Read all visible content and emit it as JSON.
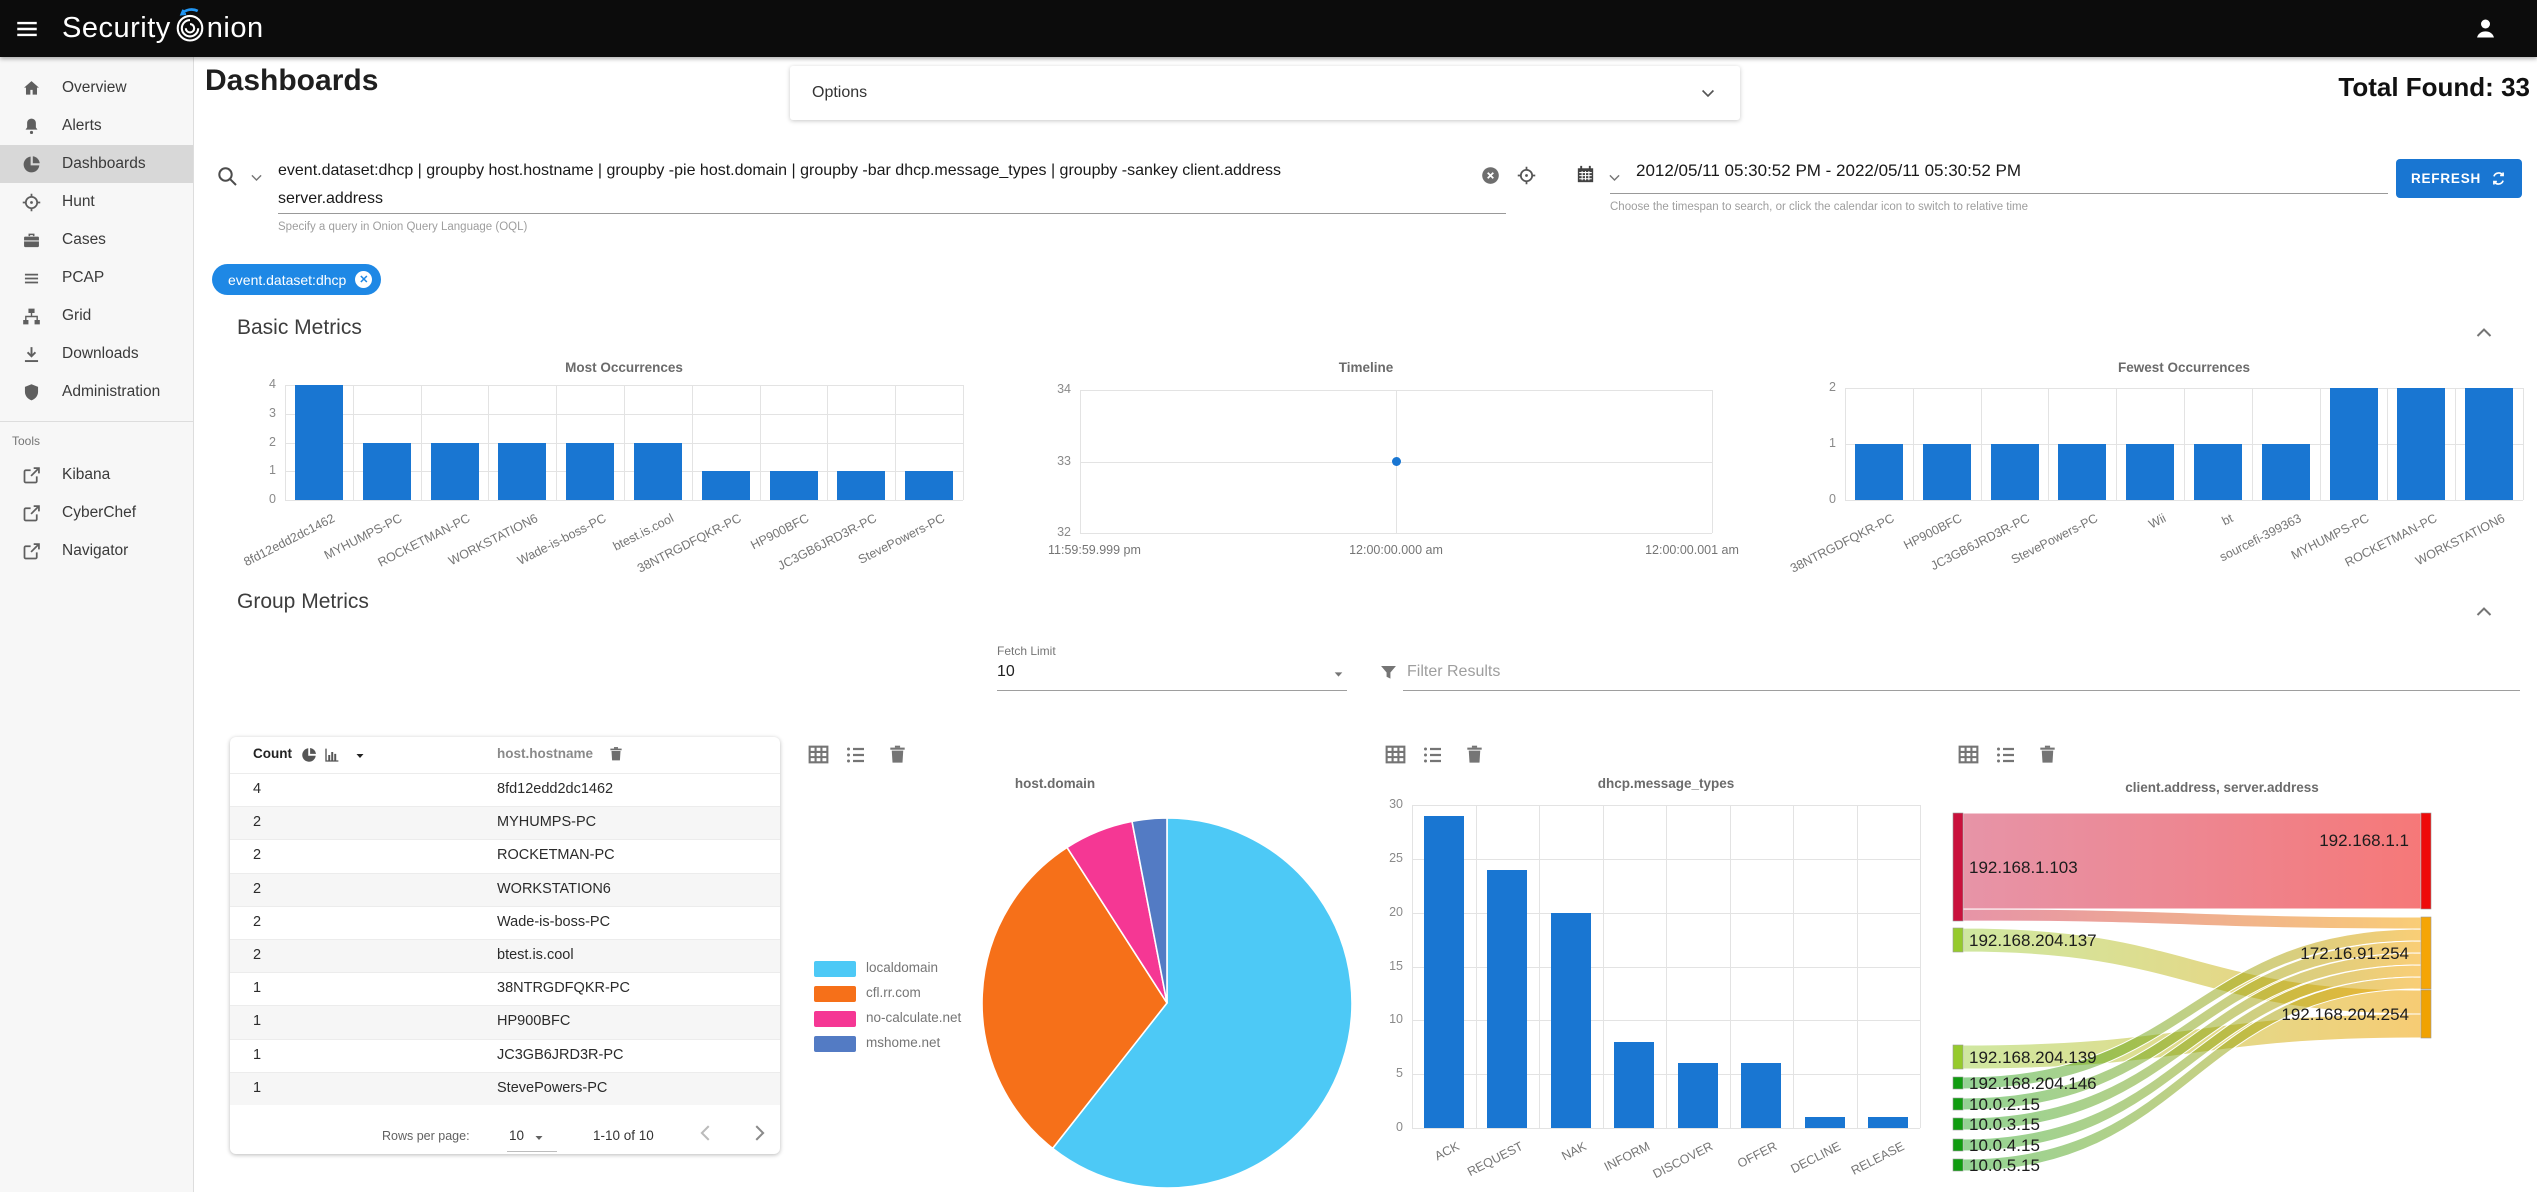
{
  "topbar": {
    "logo_prefix": "Security",
    "logo_suffix": "nion"
  },
  "header": {
    "title": "Dashboards",
    "options_label": "Options",
    "total_found": "Total Found: 33"
  },
  "sidebar": {
    "items": [
      {
        "label": "Overview",
        "icon": "home"
      },
      {
        "label": "Alerts",
        "icon": "bell"
      },
      {
        "label": "Dashboards",
        "icon": "pie",
        "selected": true
      },
      {
        "label": "Hunt",
        "icon": "crosshair"
      },
      {
        "label": "Cases",
        "icon": "briefcase"
      },
      {
        "label": "PCAP",
        "icon": "lines"
      },
      {
        "label": "Grid",
        "icon": "sitemap"
      },
      {
        "label": "Downloads",
        "icon": "download"
      },
      {
        "label": "Administration",
        "icon": "shield"
      }
    ],
    "tools_label": "Tools",
    "tools": [
      {
        "label": "Kibana",
        "icon": "external"
      },
      {
        "label": "CyberChef",
        "icon": "external"
      },
      {
        "label": "Navigator",
        "icon": "external"
      }
    ]
  },
  "search": {
    "query": "event.dataset:dhcp | groupby host.hostname | groupby -pie host.domain | groupby -bar dhcp.message_types | groupby -sankey client.address server.address",
    "helper": "Specify a query in Onion Query Language (OQL)",
    "date_range": "2012/05/11 05:30:52 PM - 2022/05/11 05:30:52 PM",
    "date_helper": "Choose the timespan to search, or click the calendar icon to switch to relative time",
    "refresh_label": "REFRESH"
  },
  "filter_chip": {
    "label": "event.dataset:dhcp"
  },
  "sections": {
    "basic_title": "Basic Metrics",
    "group_title": "Group Metrics"
  },
  "group_controls": {
    "fetch_limit_label": "Fetch Limit",
    "fetch_limit_value": "10",
    "filter_placeholder": "Filter Results"
  },
  "table": {
    "headers": {
      "count": "Count",
      "field": "host.hostname"
    },
    "rows": [
      {
        "count": 4,
        "value": "8fd12edd2dc1462"
      },
      {
        "count": 2,
        "value": "MYHUMPS-PC"
      },
      {
        "count": 2,
        "value": "ROCKETMAN-PC"
      },
      {
        "count": 2,
        "value": "WORKSTATION6"
      },
      {
        "count": 2,
        "value": "Wade-is-boss-PC"
      },
      {
        "count": 2,
        "value": "btest.is.cool"
      },
      {
        "count": 1,
        "value": "38NTRGDFQKR-PC"
      },
      {
        "count": 1,
        "value": "HP900BFC"
      },
      {
        "count": 1,
        "value": "JC3GB6JRD3R-PC"
      },
      {
        "count": 1,
        "value": "StevePowers-PC"
      }
    ],
    "footer": {
      "rows_per_page_label": "Rows per page:",
      "rows_per_page_value": "10",
      "range_label": "1-10 of 10"
    }
  },
  "chart_data": [
    {
      "type": "bar",
      "title": "Most Occurrences",
      "categories": [
        "8fd12edd2dc1462",
        "MYHUMPS-PC",
        "ROCKETMAN-PC",
        "WORKSTATION6",
        "Wade-is-boss-PC",
        "btest.is.cool",
        "38NTRGDFQKR-PC",
        "HP900BFC",
        "JC3GB6JRD3R-PC",
        "StevePowers-PC"
      ],
      "values": [
        4,
        2,
        2,
        2,
        2,
        2,
        1,
        1,
        1,
        1
      ],
      "ylim": [
        0,
        4
      ],
      "yticks": [
        0,
        1,
        2,
        3,
        4
      ],
      "bar_color": "#1976d2",
      "grid": true
    },
    {
      "type": "scatter",
      "title": "Timeline",
      "x_tick_labels": [
        "11:59:59.999 pm",
        "12:00:00.000 am",
        "12:00:00.001 am"
      ],
      "points": [
        {
          "x": "12:00:00.000 am",
          "y": 33
        }
      ],
      "ylim": [
        32,
        34
      ],
      "yticks": [
        34,
        33,
        32
      ],
      "point_color": "#1976d2",
      "grid": true
    },
    {
      "type": "bar",
      "title": "Fewest Occurrences",
      "categories": [
        "38NTRGDFQKR-PC",
        "HP900BFC",
        "JC3GB6JRD3R-PC",
        "StevePowers-PC",
        "Wii",
        "bt",
        "sourcefi-399363",
        "MYHUMPS-PC",
        "ROCKETMAN-PC",
        "WORKSTATION6"
      ],
      "values": [
        1,
        1,
        1,
        1,
        1,
        1,
        1,
        2,
        2,
        2
      ],
      "ylim": [
        0,
        2
      ],
      "yticks": [
        0,
        1,
        2
      ],
      "bar_color": "#1976d2",
      "grid": true
    },
    {
      "type": "pie",
      "title": "host.domain",
      "labels": [
        "localdomain",
        "cfl.rr.com",
        "no-calculate.net",
        "mshome.net"
      ],
      "values": [
        20,
        10,
        2,
        1
      ],
      "colors": [
        "#4dc9f6",
        "#f67019",
        "#f53794",
        "#537bc4"
      ],
      "legend_position": "left"
    },
    {
      "type": "bar",
      "title": "dhcp.message_types",
      "categories": [
        "ACK",
        "REQUEST",
        "NAK",
        "INFORM",
        "DISCOVER",
        "OFFER",
        "DECLINE",
        "RELEASE"
      ],
      "values": [
        29,
        24,
        20,
        8,
        6,
        6,
        1,
        1
      ],
      "ylim": [
        0,
        30
      ],
      "yticks": [
        0,
        5,
        10,
        15,
        20,
        25,
        30
      ],
      "bar_color": "#1976d2",
      "grid": true
    },
    {
      "type": "sankey",
      "title": "client.address, server.address",
      "nodes": {
        "left": [
          {
            "label": "192.168.1.103",
            "color": "#c9113c"
          },
          {
            "label": "192.168.204.137",
            "color": "#96ca2d"
          },
          {
            "label": "192.168.204.139",
            "color": "#96ca2d"
          },
          {
            "label": "192.168.204.146",
            "color": "#109c10"
          },
          {
            "label": "10.0.2.15",
            "color": "#109c10"
          },
          {
            "label": "10.0.3.15",
            "color": "#109c10"
          },
          {
            "label": "10.0.4.15",
            "color": "#109c10"
          },
          {
            "label": "10.0.5.15",
            "color": "#109c10"
          }
        ],
        "right": [
          {
            "label": "192.168.1.1",
            "color": "#ee0a0a"
          },
          {
            "label": "172.16.91.254",
            "color": "#f5a506"
          },
          {
            "label": "192.168.204.254",
            "color": "#f0a202"
          }
        ]
      },
      "links": [
        {
          "source": "192.168.1.103",
          "target": "192.168.1.1",
          "value": 8
        },
        {
          "source": "192.168.1.103",
          "target": "172.16.91.254",
          "value": 1
        },
        {
          "source": "192.168.204.137",
          "target": "192.168.204.254",
          "value": 2
        },
        {
          "source": "192.168.204.139",
          "target": "192.168.204.254",
          "value": 2
        },
        {
          "source": "192.168.204.146",
          "target": "172.16.91.254",
          "value": 1
        },
        {
          "source": "10.0.2.15",
          "target": "172.16.91.254",
          "value": 1
        },
        {
          "source": "10.0.3.15",
          "target": "172.16.91.254",
          "value": 1
        },
        {
          "source": "10.0.4.15",
          "target": "172.16.91.254",
          "value": 1
        },
        {
          "source": "10.0.5.15",
          "target": "172.16.91.254",
          "value": 1
        }
      ]
    }
  ],
  "colors": {
    "accent": "#1976d2",
    "chip": "#1e88e5",
    "bar": "#1976d2",
    "topbar": "#0c0c0c"
  }
}
